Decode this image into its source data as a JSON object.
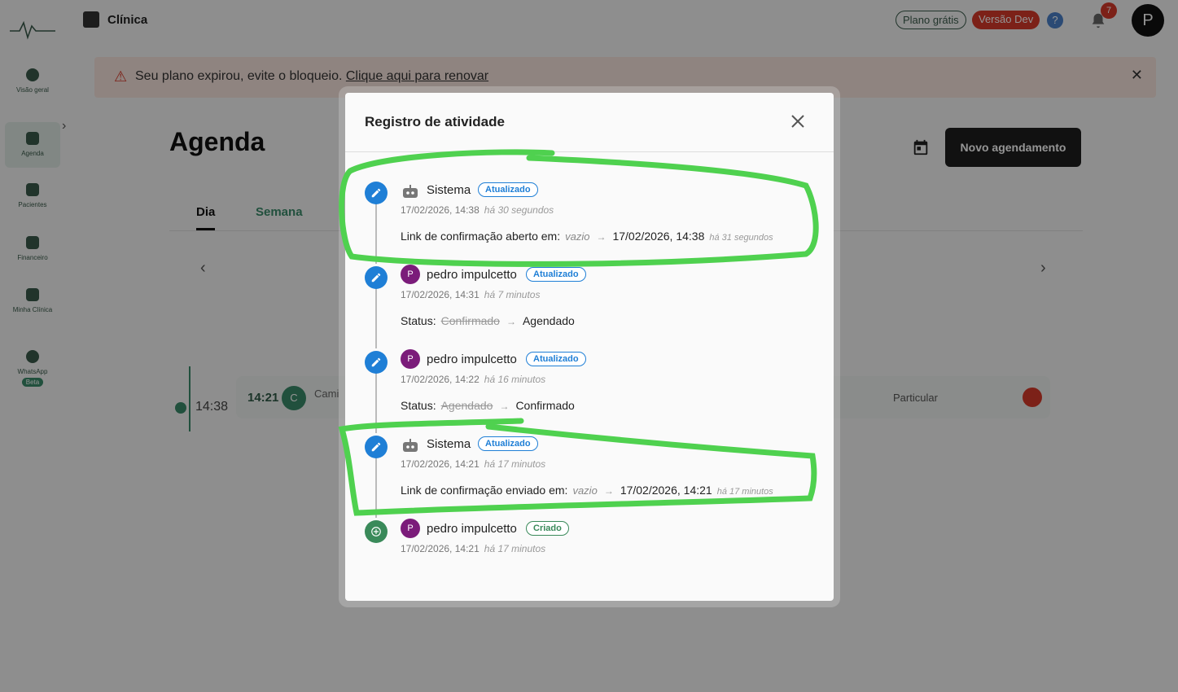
{
  "app": {
    "clinic_name": "Clínica",
    "plan_free": "Plano grátis",
    "version_dev": "Versão Dev",
    "help": "?",
    "notifications_count": "7",
    "user_initial": "P"
  },
  "sidebar": {
    "items": [
      {
        "label": "Visão geral",
        "icon": "pie-chart-icon"
      },
      {
        "label": "Agenda",
        "icon": "calendar-icon"
      },
      {
        "label": "Pacientes",
        "icon": "patients-icon"
      },
      {
        "label": "Financeiro",
        "icon": "wallet-icon"
      },
      {
        "label": "Minha Clínica",
        "icon": "building-icon"
      },
      {
        "label": "WhatsApp",
        "icon": "whatsapp-icon",
        "badge": "Beta"
      }
    ]
  },
  "banner": {
    "text": "Seu plano expirou, evite o bloqueio. ",
    "link": "Clique aqui para renovar"
  },
  "page": {
    "title": "Agenda",
    "new_button": "Novo agendamento",
    "tabs": [
      "Dia",
      "Semana"
    ],
    "current_time": "14:38",
    "appointment": {
      "time": "14:21",
      "initial": "C",
      "name": "Cami",
      "type": "Particular"
    }
  },
  "modal": {
    "title": "Registro de atividade",
    "entries": [
      {
        "actor": "Sistema",
        "actor_type": "system",
        "tag": "Atualizado",
        "kind": "update",
        "timestamp": "17/02/2026, 14:38",
        "relative": "há 30 segundos",
        "field": "Link de confirmação aberto em:",
        "old": "vazio",
        "new": "17/02/2026, 14:38",
        "new_relative": "há 31 segundos"
      },
      {
        "actor": "pedro impulcetto",
        "actor_initial": "P",
        "actor_type": "user",
        "tag": "Atualizado",
        "kind": "update",
        "timestamp": "17/02/2026, 14:31",
        "relative": "há 7 minutos",
        "field": "Status:",
        "old": "Confirmado",
        "new": "Agendado"
      },
      {
        "actor": "pedro impulcetto",
        "actor_initial": "P",
        "actor_type": "user",
        "tag": "Atualizado",
        "kind": "update",
        "timestamp": "17/02/2026, 14:22",
        "relative": "há 16 minutos",
        "field": "Status:",
        "old": "Agendado",
        "new": "Confirmado"
      },
      {
        "actor": "Sistema",
        "actor_type": "system",
        "tag": "Atualizado",
        "kind": "update",
        "timestamp": "17/02/2026, 14:21",
        "relative": "há 17 minutos",
        "field": "Link de confirmação enviado em:",
        "old": "vazio",
        "new": "17/02/2026, 14:21",
        "new_relative": "há 17 minutos"
      },
      {
        "actor": "pedro impulcetto",
        "actor_initial": "P",
        "actor_type": "user",
        "tag": "Criado",
        "kind": "create",
        "timestamp": "17/02/2026, 14:21",
        "relative": "há 17 minutos"
      }
    ]
  },
  "colors": {
    "accent": "#1f7fd6",
    "brand": "#3a8a6a",
    "created": "#3a8a5a",
    "highlight": "#4fd14f",
    "danger": "#d63a2a"
  }
}
